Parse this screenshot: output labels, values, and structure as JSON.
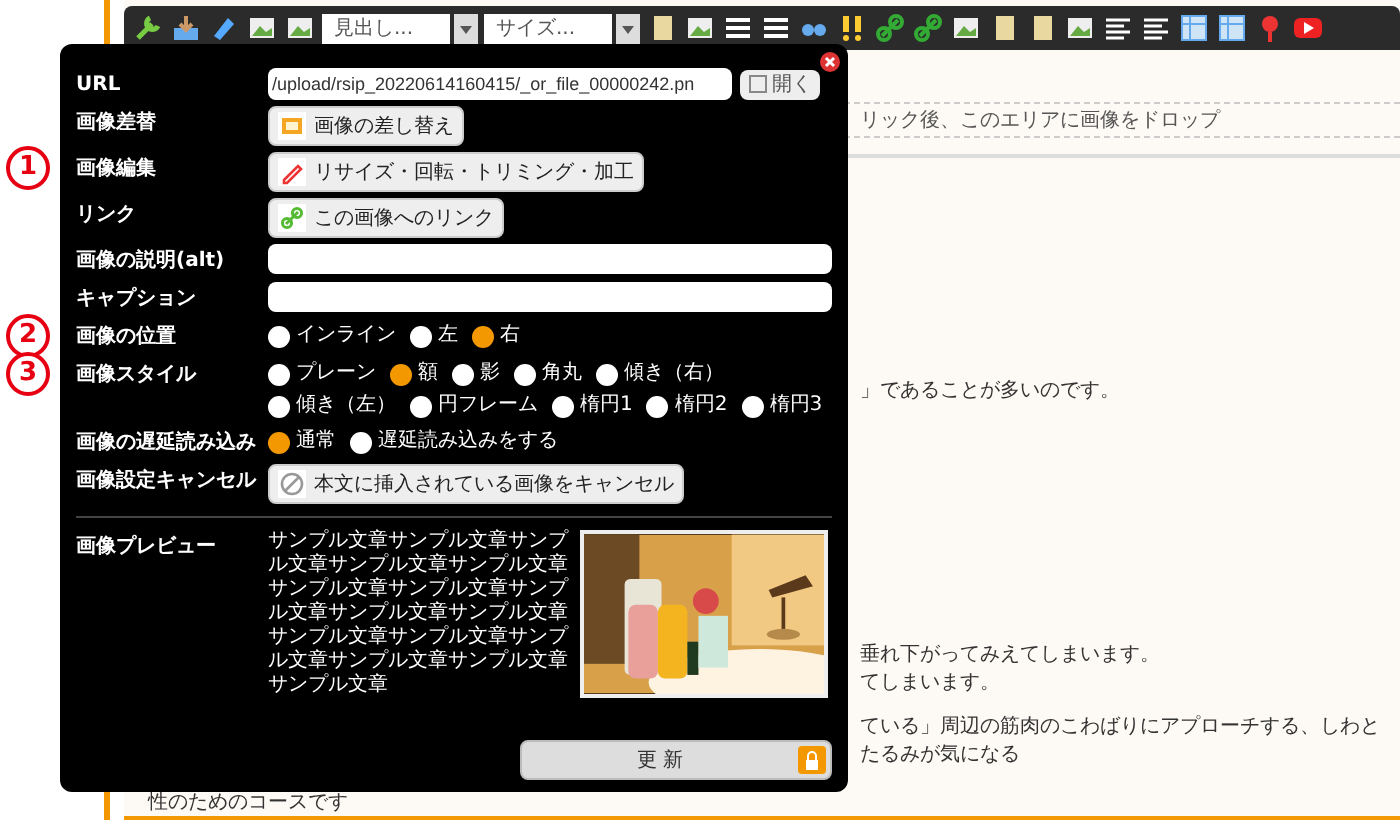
{
  "toolbar": {
    "heading_dropdown": "見出し...",
    "size_dropdown": "サイズ..."
  },
  "editor": {
    "drop_hint": "リック後、このエリアに画像をドロップ",
    "paragraphs": [
      "」であることが多いのです。",
      "垂れ下がってみえてしまいます。",
      "てしまいます。",
      "ている」周辺の筋肉のこわばりにアプローチする、しわとたるみが気になる"
    ],
    "bottom_line": "性のためのコースです"
  },
  "dialog": {
    "rows": [
      {
        "kind": "url",
        "label": "URL",
        "value": "/upload/rsip_20220614160415/_or_file_00000242.pn",
        "button": "開く"
      },
      {
        "kind": "button",
        "label": "画像差替",
        "button": "画像の差し替え"
      },
      {
        "kind": "button",
        "label": "画像編集",
        "button": "リサイズ・回転・トリミング・加工",
        "marker": "1"
      },
      {
        "kind": "button",
        "label": "リンク",
        "button": "この画像へのリンク"
      },
      {
        "kind": "text",
        "label": "画像の説明(alt)"
      },
      {
        "kind": "text",
        "label": "キャプション"
      },
      {
        "kind": "radio",
        "label": "画像の位置",
        "marker": "2",
        "options": [
          {
            "label": "インライン",
            "selected": false
          },
          {
            "label": "左",
            "selected": false
          },
          {
            "label": "右",
            "selected": true
          }
        ]
      },
      {
        "kind": "radio",
        "label": "画像スタイル",
        "marker": "3",
        "options": [
          {
            "label": "プレーン",
            "selected": false
          },
          {
            "label": "額",
            "selected": true
          },
          {
            "label": "影",
            "selected": false
          },
          {
            "label": "角丸",
            "selected": false
          },
          {
            "label": "傾き（右）",
            "selected": false
          },
          {
            "label": "傾き（左）",
            "selected": false
          },
          {
            "label": "円フレーム",
            "selected": false
          },
          {
            "label": "楕円1",
            "selected": false
          },
          {
            "label": "楕円2",
            "selected": false
          },
          {
            "label": "楕円3",
            "selected": false
          }
        ]
      },
      {
        "kind": "radio",
        "label": "画像の遅延読み込み",
        "options": [
          {
            "label": "通常",
            "selected": true
          },
          {
            "label": "遅延読み込みをする",
            "selected": false
          }
        ]
      },
      {
        "kind": "button",
        "label": "画像設定キャンセル",
        "button": "本文に挿入されている画像をキャンセル"
      },
      {
        "kind": "preview",
        "label": "画像プレビュー",
        "sample_text": "サンプル文章サンプル文章サンプル文章サンプル文章サンプル文章サンプル文章サンプル文章サンプル文章サンプル文章サンプル文章サンプル文章サンプル文章サンプル文章サンプル文章サンプル文章サンプル文章"
      }
    ],
    "update_button": "更 新"
  }
}
